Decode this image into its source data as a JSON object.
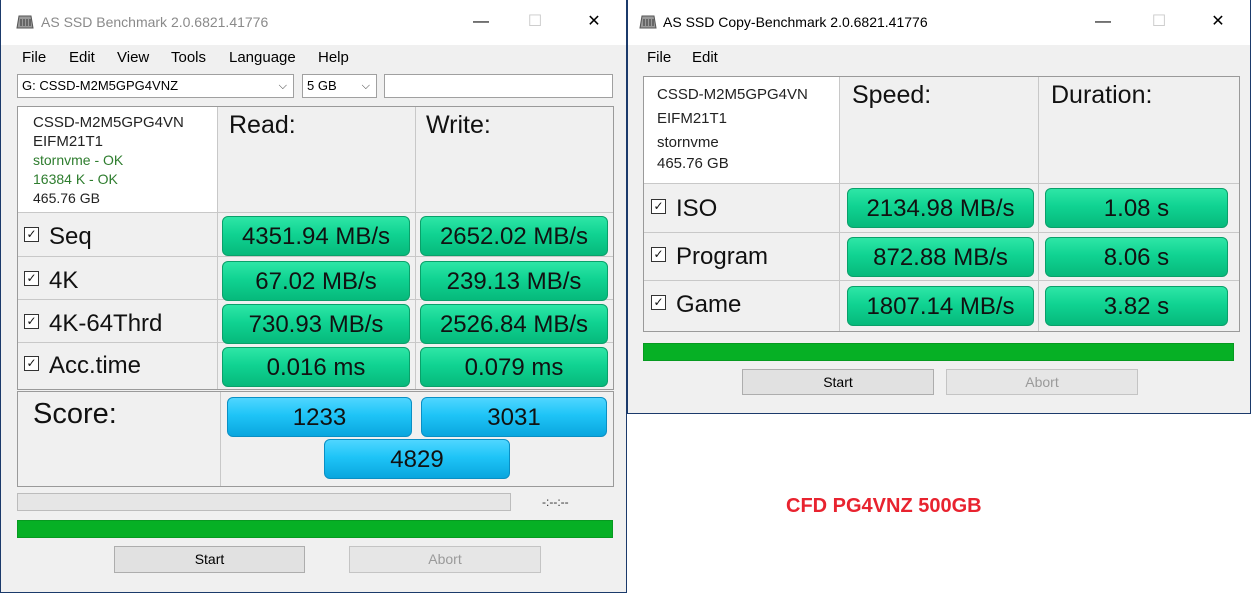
{
  "main_window": {
    "title": "AS SSD Benchmark 2.0.6821.41776",
    "controls": {
      "minimize": "—",
      "maximize": "☐",
      "close": "✕"
    },
    "menu": [
      "File",
      "Edit",
      "View",
      "Tools",
      "Language",
      "Help"
    ],
    "drive_select": "G: CSSD-M2M5GPG4VNZ",
    "size_select": "5 GB",
    "drive_info": {
      "model": "CSSD-M2M5GPG4VN",
      "firmware": "EIFM21T1",
      "driver": "stornvme - OK",
      "alignment": "16384 K - OK",
      "capacity": "465.76 GB"
    },
    "read_header": "Read:",
    "write_header": "Write:",
    "rows": [
      {
        "label": "Seq",
        "read": "4351.94 MB/s",
        "write": "2652.02 MB/s"
      },
      {
        "label": "4K",
        "read": "67.02 MB/s",
        "write": "239.13 MB/s"
      },
      {
        "label": "4K-64Thrd",
        "read": "730.93 MB/s",
        "write": "2526.84 MB/s"
      },
      {
        "label": "Acc.time",
        "read": "0.016 ms",
        "write": "0.079 ms"
      }
    ],
    "score_label": "Score:",
    "score_read": "1233",
    "score_write": "3031",
    "score_total": "4829",
    "time_display": "-:--:--",
    "start_label": "Start",
    "abort_label": "Abort"
  },
  "copy_window": {
    "title": "AS SSD Copy-Benchmark 2.0.6821.41776",
    "controls": {
      "minimize": "—",
      "maximize": "☐",
      "close": "✕"
    },
    "menu": [
      "File",
      "Edit"
    ],
    "drive_info": {
      "model": "CSSD-M2M5GPG4VN",
      "firmware": "EIFM21T1",
      "driver": "stornvme",
      "capacity": "465.76 GB"
    },
    "speed_header": "Speed:",
    "duration_header": "Duration:",
    "rows": [
      {
        "label": "ISO",
        "speed": "2134.98 MB/s",
        "duration": "1.08 s"
      },
      {
        "label": "Program",
        "speed": "872.88 MB/s",
        "duration": "8.06 s"
      },
      {
        "label": "Game",
        "speed": "1807.14 MB/s",
        "duration": "3.82 s"
      }
    ],
    "start_label": "Start",
    "abort_label": "Abort"
  },
  "caption": "CFD PG4VNZ 500GB",
  "colors": {
    "result_green": "#10d392",
    "score_blue": "#1ec4f7",
    "progress_green": "#06b025",
    "caption_red": "#e8232f"
  }
}
